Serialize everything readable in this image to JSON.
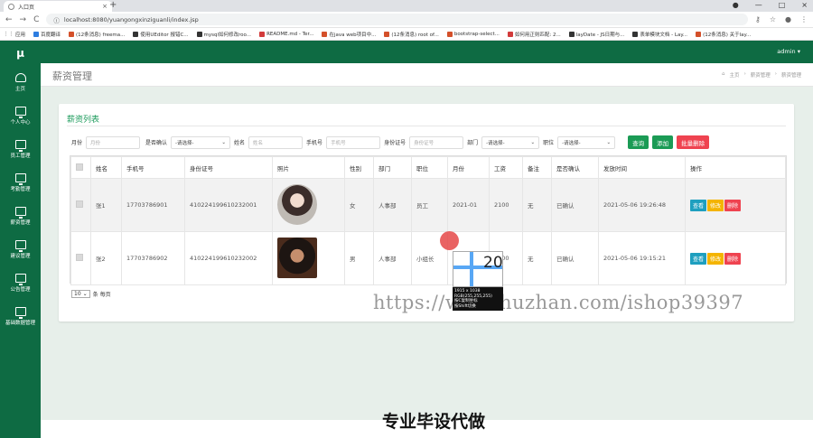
{
  "browser": {
    "tab_title": "入口页",
    "tab_close": "×",
    "new_tab": "+",
    "window_controls": [
      "●",
      "—",
      "□",
      "×"
    ],
    "back": "←",
    "forward": "→",
    "reload": "C",
    "url": "localhost:8080/yuangongxinziguanli/index.jsp",
    "bookmarks": [
      "应用",
      "百度翻译",
      "(12条消息) freema...",
      "使用UEditor 报错C...",
      "mysql如何修改roo...",
      "README.md - Ter...",
      "在java web项目中...",
      "(12条消息) root of...",
      "bootstrap-select...",
      "如何用正则匹配: 2...",
      "layDate - JS日期与...",
      "表单模块文档 - Lay...",
      "(12条消息) 关于lay..."
    ]
  },
  "sidebar": {
    "logo": "μ",
    "items": [
      {
        "label": "主页",
        "icon": "gauge-icon"
      },
      {
        "label": "个人中心",
        "icon": "monitor-icon"
      },
      {
        "label": "员工管理",
        "icon": "monitor-icon"
      },
      {
        "label": "考勤管理",
        "icon": "monitor-icon"
      },
      {
        "label": "薪资管理",
        "icon": "monitor-icon"
      },
      {
        "label": "建议管理",
        "icon": "monitor-icon"
      },
      {
        "label": "公告管理",
        "icon": "monitor-icon"
      },
      {
        "label": "基础数据管理",
        "icon": "monitor-icon"
      }
    ]
  },
  "topbar": {
    "user": "admin ▾"
  },
  "header": {
    "title": "薪资管理",
    "breadcrumb": [
      "主页",
      "薪资管理",
      "薪资管理"
    ]
  },
  "panel": {
    "title": "薪资列表"
  },
  "filters": {
    "month_label": "月份",
    "month_placeholder": "月份",
    "confirmed_label": "是否确认",
    "confirmed_value": "-请选择-",
    "name_label": "姓名",
    "name_placeholder": "姓名",
    "phone_label": "手机号",
    "phone_placeholder": "手机号",
    "idcard_label": "身份证号",
    "idcard_placeholder": "身份证号",
    "dept_label": "部门",
    "dept_value": "-请选择-",
    "position_label": "职位",
    "position_value": "-请选择-",
    "search_btn": "查询",
    "add_btn": "添加",
    "batch_delete_btn": "批量删除"
  },
  "table": {
    "columns": [
      "",
      "姓名",
      "手机号",
      "身份证号",
      "照片",
      "性别",
      "部门",
      "职位",
      "月份",
      "工资",
      "备注",
      "是否确认",
      "发放时间",
      "操作"
    ],
    "rows": [
      {
        "name": "张1",
        "phone": "17703786901",
        "idcard": "410224199610232001",
        "gender": "女",
        "dept": "人事部",
        "position": "员工",
        "month": "2021-01",
        "salary": "2100",
        "remark": "无",
        "confirmed": "已确认",
        "time": "2021-05-06 19:26:48"
      },
      {
        "name": "张2",
        "phone": "17703786902",
        "idcard": "410224199610232002",
        "gender": "男",
        "dept": "人事部",
        "position": "小组长",
        "month": "2021-01",
        "salary": "2000",
        "remark": "无",
        "confirmed": "已确认",
        "time": "2021-05-06 19:15:21"
      }
    ],
    "actions": {
      "view": "查看",
      "edit": "修改",
      "delete": "删除"
    }
  },
  "pager": {
    "page_size": "10",
    "per_page_label": "条 每页"
  },
  "overlay": {
    "watermark": "https://www.huzhan.com/ishop39397",
    "magnifier_value": "20",
    "magnifier_info": [
      "1915 x 1038",
      "RGB(255,255,255)",
      "按C复制坐标",
      "按Shift切换"
    ],
    "caption": "专业毕设代做"
  }
}
